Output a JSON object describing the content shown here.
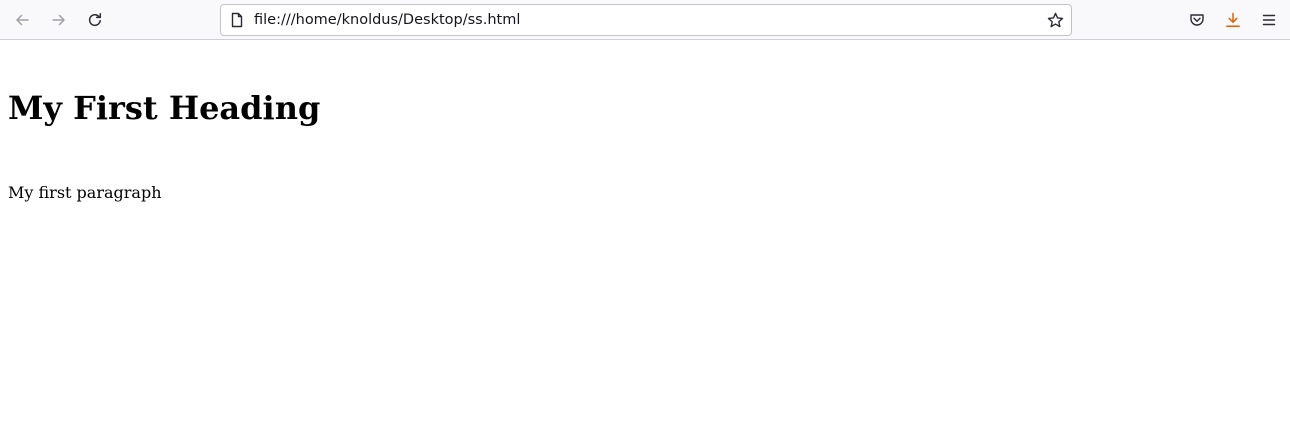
{
  "browser": {
    "url": "file:///home/knoldus/Desktop/ss.html",
    "icons": {
      "back": "back-arrow-icon",
      "forward": "forward-arrow-icon",
      "reload": "reload-icon",
      "page": "page-icon",
      "bookmark": "star-icon",
      "pocket": "pocket-icon",
      "downloads": "download-icon",
      "menu": "hamburger-menu-icon"
    },
    "colors": {
      "toolbar_bg": "#f9f9fb",
      "download_accent": "#e66000",
      "disabled_icon": "#a0a0a6",
      "icon": "#2b2a33"
    }
  },
  "page": {
    "heading": "My First Heading",
    "paragraph": "My first paragraph"
  }
}
